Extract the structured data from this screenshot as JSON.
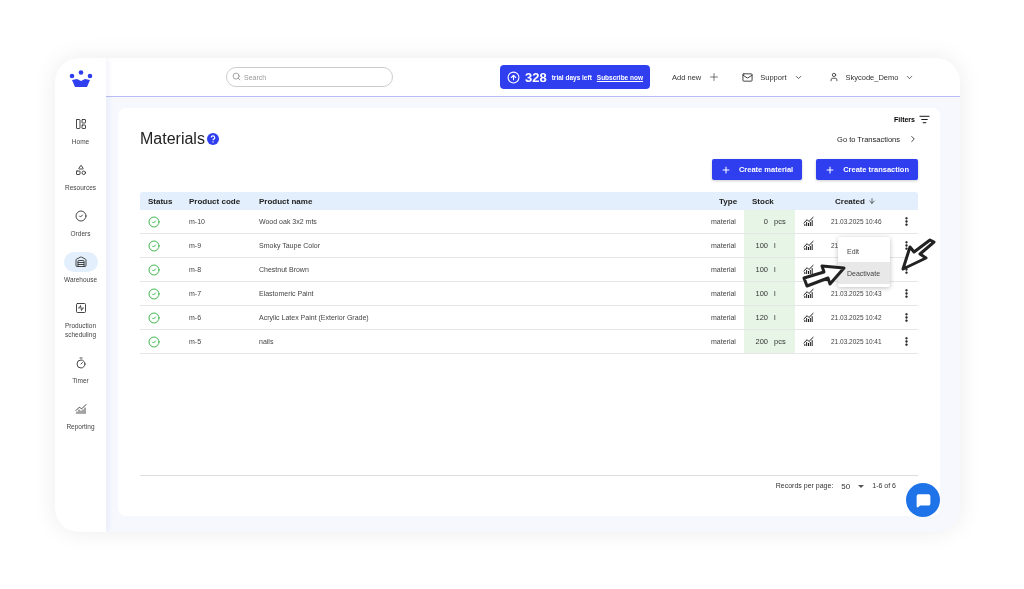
{
  "sidebar": {
    "items": [
      {
        "label": "Home",
        "selected": false
      },
      {
        "label": "Resources",
        "selected": false
      },
      {
        "label": "Orders",
        "selected": false
      },
      {
        "label": "Warehouse",
        "selected": true
      },
      {
        "label": "Production scheduling",
        "selected": false
      },
      {
        "label": "Timer",
        "selected": false
      },
      {
        "label": "Reporting",
        "selected": false
      }
    ]
  },
  "topbar": {
    "search": {
      "placeholder": "Search"
    },
    "trial": {
      "days": "328",
      "text": "trial days left",
      "link": "Subscribe now"
    },
    "add_new": "Add new",
    "support": "Support",
    "user": "Skycode_Demo"
  },
  "filters": "Filters",
  "page": {
    "title": "Materials",
    "go_to": "Go to Transactions",
    "buttons": [
      "Create material",
      "Create transaction"
    ]
  },
  "table": {
    "columns": [
      "Status",
      "Product code",
      "Product name",
      "Type",
      "Stock",
      "Created"
    ],
    "rows": [
      {
        "active": true,
        "code": "m-10",
        "name": "Wood oak 3x2 mts",
        "type": "material",
        "stock": "0",
        "unit": "pcs",
        "created": "21.03.2025 10:46"
      },
      {
        "active": true,
        "code": "m-9",
        "name": "Smoky Taupe Color",
        "type": "material",
        "stock": "100",
        "unit": "l",
        "created": "21."
      },
      {
        "active": true,
        "code": "m-8",
        "name": "Chestnut Brown",
        "type": "material",
        "stock": "100",
        "unit": "l"
      },
      {
        "active": true,
        "code": "m-7",
        "name": "Elastomeric Paint",
        "type": "material",
        "stock": "100",
        "unit": "l",
        "created": "21.03.2025 10:43"
      },
      {
        "active": true,
        "code": "m-6",
        "name": "Acrylic Latex Paint (Exterior Grade)",
        "type": "material",
        "stock": "120",
        "unit": "l",
        "created": "21.03.2025 10:42"
      },
      {
        "active": true,
        "code": "m-5",
        "name": "nails",
        "type": "material",
        "stock": "200",
        "unit": "pcs",
        "created": "21.03.2025 10:41"
      }
    ]
  },
  "context_menu": {
    "items": [
      {
        "label": "Edit",
        "selected": false
      },
      {
        "label": "Deactivate",
        "selected": true
      }
    ]
  },
  "pagination": {
    "label": "Records per page:",
    "per_page": "50",
    "range": "1-6 of 6"
  }
}
